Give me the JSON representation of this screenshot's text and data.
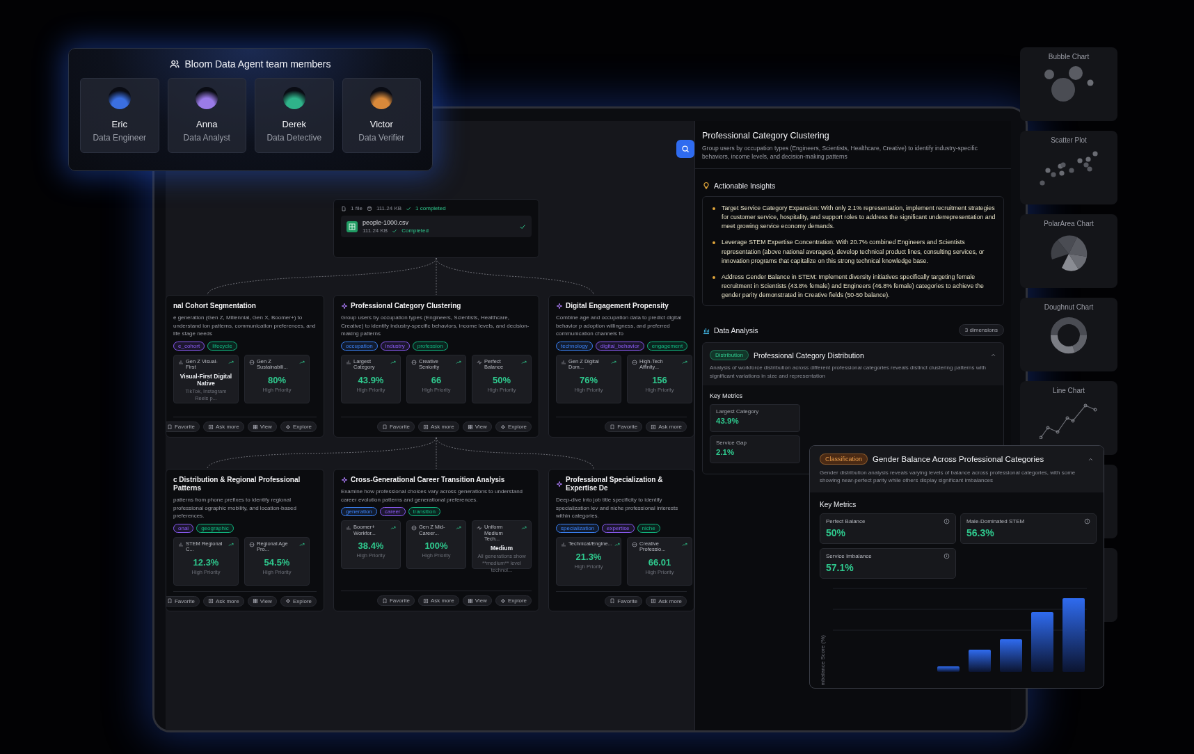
{
  "team": {
    "title": "Bloom Data Agent team members",
    "members": [
      {
        "name": "Eric",
        "role": "Data Engineer",
        "color": "#3b6fe0"
      },
      {
        "name": "Anna",
        "role": "Data Analyst",
        "color": "#9a7be8"
      },
      {
        "name": "Derek",
        "role": "Data Detective",
        "color": "#2fb38a"
      },
      {
        "name": "Victor",
        "role": "Data Verifier",
        "color": "#d9893a"
      }
    ]
  },
  "upload": {
    "file_count": "1 file",
    "total_size": "111.24 KB",
    "status": "1 completed",
    "file": {
      "name": "people-1000.csv",
      "size": "111.24 KB",
      "status": "Completed"
    }
  },
  "cards": [
    {
      "title": "nal Cohort Segmentation",
      "description": "e generation (Gen Z, Millennial, Gen X, Boomer+) to understand ion patterns, communication preferences, and life stage needs",
      "tags": [
        {
          "label": "e_cohort",
          "color": "#8b5cf6"
        },
        {
          "label": "lifecycle",
          "color": "#10b981"
        }
      ],
      "metrics": [
        {
          "kind": "text",
          "label": "Gen Z Visual-First",
          "value": "Visual-First Digital Native",
          "note": "TikTok, Instagram Reels p..."
        },
        {
          "kind": "number",
          "label": "Gen Z Sustainabili...",
          "value": "80%",
          "note": "High Priority"
        }
      ],
      "actions": [
        "Favorite",
        "Ask more",
        "View",
        "Explore"
      ]
    },
    {
      "title": "Professional Category Clustering",
      "description": "Group users by occupation types (Engineers, Scientists, Healthcare, Creative) to identify industry-specific behaviors, income levels, and decision-making patterns",
      "tags": [
        {
          "label": "occupation",
          "color": "#3b82f6"
        },
        {
          "label": "industry",
          "color": "#8b5cf6"
        },
        {
          "label": "profession",
          "color": "#10b981"
        }
      ],
      "metrics": [
        {
          "kind": "number",
          "label": "Largest Category",
          "value": "43.9%",
          "note": "High Priority"
        },
        {
          "kind": "number",
          "label": "Creative Seniority",
          "value": "66",
          "note": "High Priority"
        },
        {
          "kind": "number",
          "label": "Perfect Balance",
          "value": "50%",
          "note": "High Priority"
        }
      ],
      "actions": [
        "Favorite",
        "Ask more",
        "View",
        "Explore"
      ]
    },
    {
      "title": "Digital Engagement Propensity",
      "description": "Combine age and occupation data to predict digital behavior p adoption willingness, and preferred communication channels fo",
      "tags": [
        {
          "label": "technology",
          "color": "#3b82f6"
        },
        {
          "label": "digital_behavior",
          "color": "#8b5cf6"
        },
        {
          "label": "engagement",
          "color": "#10b981"
        }
      ],
      "metrics": [
        {
          "kind": "number",
          "label": "Gen Z Digital Dom...",
          "value": "76%",
          "note": "High Priority"
        },
        {
          "kind": "number",
          "label": "High-Tech Affinity...",
          "value": "156",
          "note": "High Priority"
        }
      ],
      "actions": [
        "Favorite",
        "Ask more"
      ]
    },
    {
      "title": "c Distribution & Regional Professional Patterns",
      "description": "patterns from phone prefixes to identify regional professional ographic mobility, and location-based preferences.",
      "tags": [
        {
          "label": "onal",
          "color": "#8b5cf6"
        },
        {
          "label": "geographic",
          "color": "#10b981"
        }
      ],
      "metrics": [
        {
          "kind": "number",
          "label": "STEM Regional C...",
          "value": "12.3%",
          "note": "High Priority"
        },
        {
          "kind": "number",
          "label": "Regional Age Pro...",
          "value": "54.5%",
          "note": "High Priority"
        }
      ],
      "actions": [
        "Favorite",
        "Ask more",
        "View",
        "Explore"
      ]
    },
    {
      "title": "Cross-Generational Career Transition Analysis",
      "description": "Examine how professional choices vary across generations to understand career evolution patterns and generational preferences.",
      "tags": [
        {
          "label": "generation",
          "color": "#3b82f6"
        },
        {
          "label": "career",
          "color": "#8b5cf6"
        },
        {
          "label": "transition",
          "color": "#10b981"
        }
      ],
      "metrics": [
        {
          "kind": "number",
          "label": "Boomer+ Workfor...",
          "value": "38.4%",
          "note": "High Priority"
        },
        {
          "kind": "number",
          "label": "Gen Z Mid-Career...",
          "value": "100%",
          "note": "High Priority"
        },
        {
          "kind": "text",
          "label": "Uniform Medium Tech...",
          "value": "Medium",
          "note": "All generations show **medium** level technol..."
        }
      ],
      "actions": [
        "Favorite",
        "Ask more",
        "View",
        "Explore"
      ]
    },
    {
      "title": "Professional Specialization & Expertise De",
      "description": "Deep-dive into job title specificity to identify specialization lev and niche professional interests within categories.",
      "tags": [
        {
          "label": "specialization",
          "color": "#3b82f6"
        },
        {
          "label": "expertise",
          "color": "#8b5cf6"
        },
        {
          "label": "niche",
          "color": "#10b981"
        }
      ],
      "metrics": [
        {
          "kind": "number",
          "label": "Technical/Engine...",
          "value": "21.3%",
          "note": "High Priority"
        },
        {
          "kind": "number",
          "label": "Creative Professio...",
          "value": "66.01",
          "note": "High Priority"
        }
      ],
      "actions": [
        "Favorite",
        "Ask more"
      ]
    }
  ],
  "detail": {
    "title": "Professional Category Clustering",
    "description": "Group users by occupation types (Engineers, Scientists, Healthcare, Creative) to identify industry-specific behaviors, income levels, and decision-making patterns",
    "insights_title": "Actionable Insights",
    "insights": [
      "Target Service Category Expansion: With only 2.1% representation, implement recruitment strategies for customer service, hospitality, and support roles to address the significant underrepresentation and meet growing service economy demands.",
      "Leverage STEM Expertise Concentration: With 20.7% combined Engineers and Scientists representation (above national averages), develop technical product lines, consulting services, or innovation programs that capitalize on this strong technical knowledge base.",
      "Address Gender Balance in STEM: Implement diversity initiatives specifically targeting female recruitment in Scientists (43.8% female) and Engineers (46.8% female) categories to achieve the gender parity demonstrated in Creative fields (50-50 balance)."
    ],
    "analysis_title": "Data Analysis",
    "dimensions": "3 dimensions",
    "distribution": {
      "badge": "Distribution",
      "title": "Professional Category Distribution",
      "description": "Analysis of workforce distribution across different professional categories reveals distinct clustering patterns with significant variations in size and representation",
      "metrics_title": "Key Metrics",
      "metrics": [
        {
          "label": "Largest Category",
          "value": "43.9%"
        },
        {
          "label": "Service Gap",
          "value": "2.1%"
        }
      ]
    }
  },
  "gender": {
    "badge": "Classification",
    "title": "Gender Balance Across Professional Categories",
    "description": "Gender distribution analysis reveals varying levels of balance across professional categories, with some showing near-perfect parity while others display significant imbalances",
    "metrics_title": "Key Metrics",
    "metrics": [
      {
        "label": "Perfect Balance",
        "value": "50%"
      },
      {
        "label": "Male-Dominated STEM",
        "value": "56.3%"
      },
      {
        "label": "Service Imbalance",
        "value": "57.1%"
      }
    ],
    "axis_label": "mbalance Score (%)"
  },
  "chart_types": [
    {
      "kind": "bubble",
      "label": "Bubble Chart"
    },
    {
      "kind": "scatter",
      "label": "Scatter Plot"
    },
    {
      "kind": "polar",
      "label": "PolarArea Chart"
    },
    {
      "kind": "doughnut",
      "label": "Doughnut Chart"
    },
    {
      "kind": "line",
      "label": "Line Chart"
    },
    {
      "kind": "empty"
    },
    {
      "kind": "empty"
    }
  ]
}
